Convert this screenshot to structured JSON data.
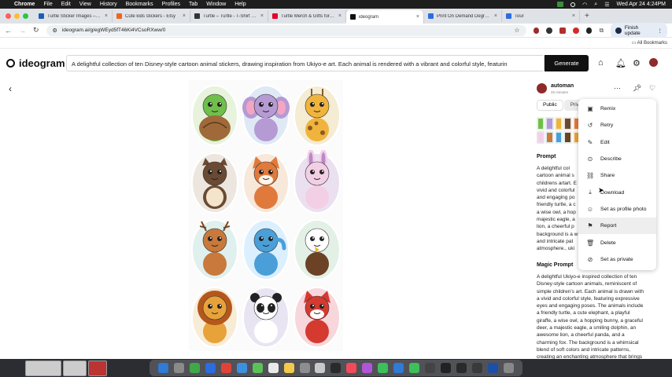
{
  "menubar": {
    "apple": "",
    "app": "Chrome",
    "items": [
      "File",
      "Edit",
      "View",
      "History",
      "Bookmarks",
      "Profiles",
      "Tab",
      "Window",
      "Help"
    ],
    "clock": "Wed Apr 24  4:24PM"
  },
  "tabs": [
    {
      "title": "Turtle Sticker Images – Brow",
      "color": "#1a5fb4"
    },
    {
      "title": "Cute kids stickers - Etsy",
      "color": "#f1641e"
    },
    {
      "title": "Turtle – Turtle - T-Shirt | Tee",
      "color": "#333333"
    },
    {
      "title": "Turtle Merch & Gifts for Sale",
      "color": "#e4002b"
    },
    {
      "title": "ideogram",
      "color": "#111111",
      "active": true
    },
    {
      "title": "Print On Demand Degree (P",
      "color": "#2d6cdf"
    },
    {
      "title": "Tour",
      "color": "#2d6cdf"
    }
  ],
  "address": {
    "url": "ideogram.ai/g/egWEyd5fT46Ki4VCsoRXww/0",
    "finish_update": "Finish update",
    "all_bookmarks": "All Bookmarks"
  },
  "header": {
    "logo": "ideogram",
    "prompt": "A delightful collection of ten Disney-style cartoon animal stickers, drawing inspiration from Ukiyo-e art. Each animal is rendered with a vibrant and colorful style, featurin",
    "generate": "Generate"
  },
  "user": {
    "name": "automan",
    "time": "25 minutes"
  },
  "visibility": {
    "public": "Public",
    "private": "Priv"
  },
  "prompt_section": {
    "title": "Prompt",
    "lines": [
      "A delightful col",
      "cartoon animal s",
      "childrens artart. E",
      "vivid and colorful",
      "and engaging po",
      "friendly turtle, a c",
      "a wise owl, a hop",
      "majestic eagle, a",
      "lion, a cheerful p",
      "background is a w",
      "and intricate pat",
      "atmosphere., uki"
    ]
  },
  "magic_prompt": {
    "title": "Magic Prompt",
    "lines": [
      "A delightful Ukiyo-e inspired collection of ten",
      "Disney-style cartoon animals, reminiscent of",
      "simple children's art. Each animal is drawn with",
      "a vivid and colorful style, featuring expressive",
      "eyes and engaging poses. The animals include",
      "a friendly turtle, a cute elephant, a playful",
      "giraffe, a wise owl, a hopping bunny, a graceful",
      "deer, a majestic eagle, a smiling dolphin, an",
      "awesome lion, a cheerful panda, and a",
      "charming fox. The background is a whimsical",
      "blend of soft colors and intricate patterns,",
      "creating an enchanting atmosphere that brings"
    ]
  },
  "menu": {
    "items": [
      {
        "label": "Remix",
        "icon": "remix-icon",
        "glyph": "▣"
      },
      {
        "label": "Retry",
        "icon": "retry-icon",
        "glyph": "↺"
      },
      {
        "label": "Edit",
        "icon": "edit-icon",
        "glyph": "✎"
      },
      {
        "label": "Describe",
        "icon": "describe-icon",
        "glyph": "⊙"
      },
      {
        "label": "Share",
        "icon": "share-icon",
        "glyph": "⛓"
      },
      {
        "label": "Download",
        "icon": "download-icon",
        "glyph": "⤓"
      },
      {
        "label": "Set as profile photo",
        "icon": "profile-photo-icon",
        "glyph": "☺"
      },
      {
        "label": "Report",
        "icon": "flag-icon",
        "glyph": "⚑"
      },
      {
        "label": "Delete",
        "icon": "trash-icon",
        "glyph": "🗑"
      },
      {
        "label": "Set as private",
        "icon": "eye-off-icon",
        "glyph": "⊘"
      }
    ]
  },
  "stickers": [
    {
      "animal": "turtle",
      "bg": "#e7f3dc",
      "body": "#6fbf4a",
      "accent": "#a0693a"
    },
    {
      "animal": "elephant",
      "bg": "#dfe9f5",
      "body": "#b59ad3",
      "accent": "#f2a6c4"
    },
    {
      "animal": "giraffe",
      "bg": "#f4ecd3",
      "body": "#f0b43c",
      "accent": "#8a5a24"
    },
    {
      "animal": "owl",
      "bg": "#ece6df",
      "body": "#6b4a33",
      "accent": "#f4e4cc"
    },
    {
      "animal": "fox",
      "bg": "#f7e8da",
      "body": "#e07a3c",
      "accent": "#fff4e8"
    },
    {
      "animal": "bunny",
      "bg": "#ebe0f0",
      "body": "#f3cfe6",
      "accent": "#b889c9"
    },
    {
      "animal": "deer",
      "bg": "#dff0ee",
      "body": "#c8793b",
      "accent": "#7fc8c0"
    },
    {
      "animal": "dolphin",
      "bg": "#dcefff",
      "body": "#4a9fd8",
      "accent": "#a9d7f0"
    },
    {
      "animal": "eagle",
      "bg": "#e3f0e6",
      "body": "#6b4226",
      "accent": "#ffffff"
    },
    {
      "animal": "lion",
      "bg": "#f7ecd6",
      "body": "#e8a23a",
      "accent": "#b5571c"
    },
    {
      "animal": "panda",
      "bg": "#e8e4f2",
      "body": "#ffffff",
      "accent": "#222222"
    },
    {
      "animal": "red fox",
      "bg": "#f7d6dc",
      "body": "#d43a2f",
      "accent": "#ffffff"
    }
  ],
  "colors": {
    "generate_bg": "#111111",
    "menu_highlight": "#eeeeee"
  }
}
